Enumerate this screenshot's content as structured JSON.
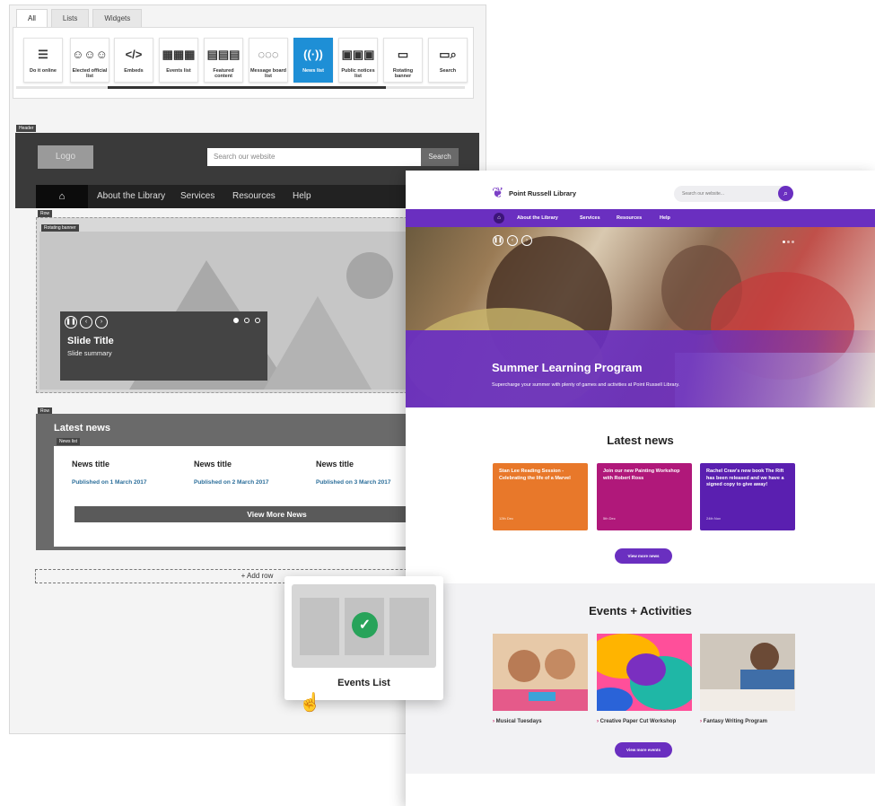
{
  "builder": {
    "tabs": [
      "All",
      "Lists",
      "Widgets"
    ],
    "widgets": [
      {
        "label": "Do it online",
        "icon": "checklist-icon",
        "glyph": "☰"
      },
      {
        "label": "Elected official list",
        "icon": "people-icon",
        "glyph": "☺☺☺"
      },
      {
        "label": "Embeds",
        "icon": "code-icon",
        "glyph": "</>"
      },
      {
        "label": "Events list",
        "icon": "calendar-grid-icon",
        "glyph": "▦▦▦"
      },
      {
        "label": "Featured content",
        "icon": "featured-grid-icon",
        "glyph": "▤▤▤"
      },
      {
        "label": "Message board list",
        "icon": "speech-icon",
        "glyph": "◌◌◌"
      },
      {
        "label": "News list",
        "icon": "broadcast-icon",
        "glyph": "((·))"
      },
      {
        "label": "Public notices list",
        "icon": "notices-icon",
        "glyph": "▣▣▣"
      },
      {
        "label": "Rotating banner",
        "icon": "image-banner-icon",
        "glyph": "▭"
      },
      {
        "label": "Search",
        "icon": "search-bar-icon",
        "glyph": "▭⌕"
      }
    ],
    "selected_widget": "News list",
    "header_tag": "Header",
    "row_tag": "Row",
    "rotating_banner_tag": "Rotating banner",
    "news_list_tag": "News list",
    "logo": "Logo",
    "search_placeholder": "Search our website",
    "search_button": "Search",
    "nav": [
      "About the Library",
      "Services",
      "Resources",
      "Help"
    ],
    "slide_title": "Slide Title",
    "slide_summary": "Slide summary",
    "latest_news": "Latest news",
    "news": [
      {
        "title": "News title",
        "published": "Published on 1 March 2017"
      },
      {
        "title": "News title",
        "published": "Published on 2 March 2017"
      },
      {
        "title": "News title",
        "published": "Published on 3 March 2017"
      }
    ],
    "view_more": "View More News",
    "add_row": "+ Add row"
  },
  "drag_card": {
    "label": "Events List"
  },
  "site": {
    "name": "Point Russell Library",
    "search_placeholder": "Search our website...",
    "nav": [
      "About the Library",
      "Services",
      "Resources",
      "Help"
    ],
    "hero_title": "Summer Learning Program",
    "hero_subtitle": "Supercharge your summer with plenty of games and activities at Point Russell Library.",
    "latest_news": "Latest news",
    "news_cards": [
      {
        "text": "Stan Lee Reading Session - Celebrating the life of a Marvel",
        "date": "12th Dec",
        "color": "#e8782a"
      },
      {
        "text": "Join our new Painting Workshop with Robert Ross",
        "date": "5th Dec",
        "color": "#b0187a"
      },
      {
        "text": "Rachel Craw's new book The Rift has been released and we have a signed copy to give away!",
        "date": "24th Nov",
        "color": "#5a1fb0"
      }
    ],
    "view_more_news": "View more news",
    "events_heading": "Events + Activities",
    "events": [
      {
        "caption": "Musical Tuesdays"
      },
      {
        "caption": "Creative Paper Cut Workshop"
      },
      {
        "caption": "Fantasy Writing Program"
      }
    ],
    "view_more_events": "View more events"
  }
}
